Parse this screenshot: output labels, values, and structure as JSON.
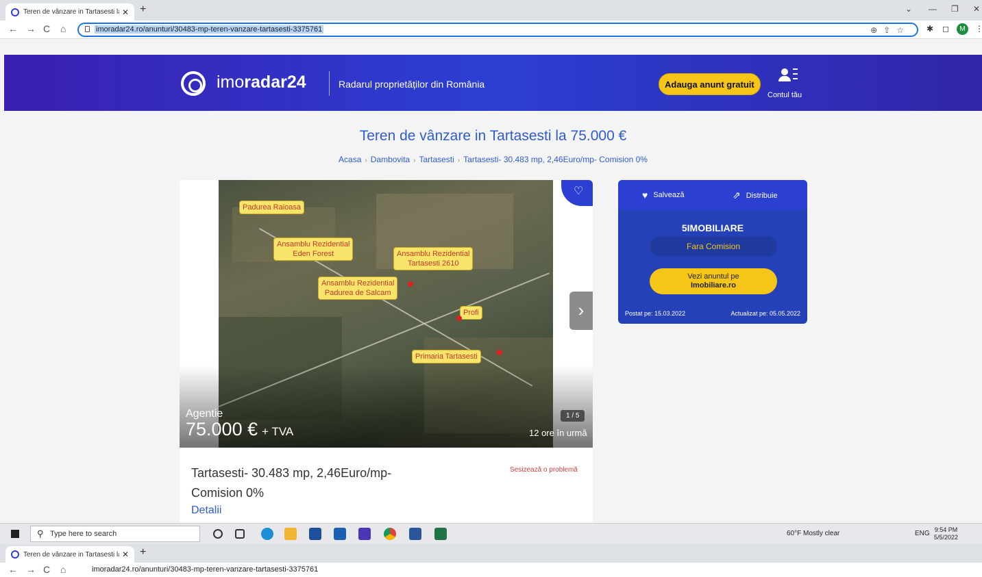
{
  "browser": {
    "tab_title": "Teren de vânzare in Tartasesti la",
    "tab_close": "✕",
    "new_tab": "+",
    "url": "imoradar24.ro/anunturi/30483-mp-teren-vanzare-tartasesti-3375761",
    "back": "←",
    "forward": "→",
    "reload": "C",
    "home": "⌂",
    "omni_icons": "⊕⇪☆",
    "ext_puzzle": "✱",
    "ext_panel": "◻",
    "profile_initial": "M",
    "minimize": "—",
    "restore": "❐",
    "close": "✕",
    "chevron": "⌄",
    "menu": "⋮"
  },
  "header": {
    "logo_light": "imo",
    "logo_bold": "radar24",
    "tagline": "Radarul proprietăților din România",
    "add_button": "Adauga anunt gratuit",
    "account_label": "Contul tău"
  },
  "page": {
    "title": "Teren de vânzare in Tartasesti la 75.000 €",
    "breadcrumbs": [
      "Acasa",
      "Dambovita",
      "Tartasesti",
      "Tartasesti- 30.483 mp, 2,46Euro/mp- Comision 0%"
    ],
    "breadcrumb_sep": "›"
  },
  "listing": {
    "map_labels": {
      "l1": "Padurea Raioasa",
      "l2a": "Ansamblu Rezidential",
      "l2b": "Eden Forest",
      "l3a": "Ansamblu Rezidential",
      "l3b": "Tartasesti 2610",
      "l4a": "Ansamblu Rezidential",
      "l4b": "Padurea de Salcam",
      "l5": "Profi",
      "l6": "Primaria Tartasesti"
    },
    "favorite_icon": "♡",
    "next_icon": "›",
    "seller_type": "Agentie",
    "price": "75.000 €",
    "price_suffix": "+ TVA",
    "photo_counter": "1 / 5",
    "posted_ago": "12 ore în urmă",
    "title": "Tartasesti- 30.483 mp, 2,46Euro/mp- Comision 0%",
    "report": "Sesizează o problemă",
    "details": "Detalii"
  },
  "panel": {
    "save": "Salvează",
    "share": "Distribuie",
    "save_icon": "♥",
    "share_icon": "⇗",
    "agency": "5IMOBILIARE",
    "no_commission": "Fara Comision",
    "external_line1": "Vezi anuntul pe",
    "external_line2": "Imobiliare.ro",
    "posted": "Postat pe: 15.03.2022",
    "updated": "Actualizat pe: 05.05.2022"
  },
  "taskbar": {
    "search_placeholder": "Type here to search",
    "weather": "60°F  Mostly clear",
    "lang": "ENG",
    "time": "9:54 PM",
    "date": "5/5/2022"
  },
  "colors": {
    "brand_blue": "#2b3fd3",
    "accent_yellow": "#f5c518",
    "link_blue": "#2f5bd3",
    "report_red": "#d23f3f"
  }
}
